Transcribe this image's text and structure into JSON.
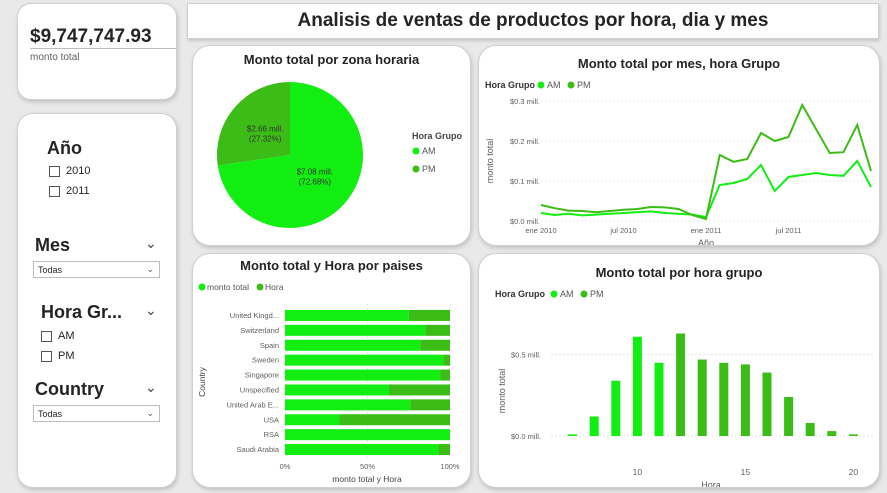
{
  "dashboard": {
    "title": "Analisis de ventas de productos por hora, dia y mes"
  },
  "kpi": {
    "value": "$9,747,747.93",
    "label": "monto total"
  },
  "slicers": {
    "year": {
      "title": "Año",
      "options": [
        "2010",
        "2011"
      ]
    },
    "month": {
      "title": "Mes",
      "selected": "Todas"
    },
    "hour_group": {
      "title": "Hora Gr...",
      "options": [
        "AM",
        "PM"
      ]
    },
    "country": {
      "title": "Country",
      "selected": "Todas"
    }
  },
  "colors": {
    "am": "#12ee12",
    "pm": "#3cbc16",
    "grid": "#e4e4e4",
    "axis_text": "#605e5c"
  },
  "chart_data": [
    {
      "id": "pie",
      "type": "pie",
      "title": "Monto total por zona horaria",
      "legend_title": "Hora Grupo",
      "legend_position": "right",
      "slices": [
        {
          "name": "AM",
          "value": 7.08,
          "label": "$7.08 mill.",
          "percent": "(72.68%)",
          "color": "#12ee12"
        },
        {
          "name": "PM",
          "value": 2.66,
          "label": "$2.66 mill.",
          "percent": "(27.32%)",
          "color": "#3cbc16"
        }
      ]
    },
    {
      "id": "line",
      "type": "line",
      "title": "Monto total por mes, hora Grupo",
      "legend_title": "Hora Grupo",
      "legend_position": "top-left",
      "xlabel": "Año",
      "ylabel": "monto total",
      "x_ticks": [
        {
          "label": "ene 2010",
          "index": 0
        },
        {
          "label": "jul 2010",
          "index": 6
        },
        {
          "label": "ene 2011",
          "index": 12
        },
        {
          "label": "jul 2011",
          "index": 18
        }
      ],
      "y_ticks": [
        {
          "label": "$0.0 mill.",
          "value": 0.0
        },
        {
          "label": "$0.1 mill.",
          "value": 0.1
        },
        {
          "label": "$0.2 mill.",
          "value": 0.2
        },
        {
          "label": "$0.3 mill.",
          "value": 0.3
        }
      ],
      "ylim": [
        0,
        0.3
      ],
      "x_count": 24,
      "series": [
        {
          "name": "AM",
          "color": "#12ee12",
          "values": [
            0.02,
            0.015,
            0.018,
            0.014,
            0.016,
            0.018,
            0.02,
            0.022,
            0.024,
            0.02,
            0.018,
            0.016,
            0.01,
            0.09,
            0.095,
            0.105,
            0.14,
            0.075,
            0.11,
            0.115,
            0.12,
            0.115,
            0.113,
            0.15,
            0.085
          ]
        },
        {
          "name": "PM",
          "color": "#3cbc16",
          "values": [
            0.04,
            0.032,
            0.026,
            0.025,
            0.022,
            0.025,
            0.028,
            0.03,
            0.035,
            0.034,
            0.03,
            0.015,
            0.005,
            0.165,
            0.148,
            0.155,
            0.22,
            0.2,
            0.21,
            0.29,
            0.23,
            0.17,
            0.172,
            0.24,
            0.125
          ]
        }
      ]
    },
    {
      "id": "hbar",
      "type": "bar",
      "orientation": "horizontal",
      "stacked_percent": true,
      "title": "Monto total y Hora por paises",
      "legend_position": "top-left",
      "legend": [
        "monto total",
        "Hora"
      ],
      "xlabel": "monto total y Hora",
      "ylabel": "Country",
      "x_ticks": [
        "0%",
        "50%",
        "100%"
      ],
      "categories": [
        "United Kingd...",
        "Switzerland",
        "Spain",
        "Sweden",
        "Singapore",
        "Unspecified",
        "United Arab E...",
        "USA",
        "RSA",
        "Saudi Arabia"
      ],
      "series": [
        {
          "name": "monto total",
          "color": "#12ee12",
          "values": [
            0.75,
            0.85,
            0.82,
            0.96,
            0.94,
            0.63,
            0.76,
            0.33,
            1.0,
            0.93
          ]
        },
        {
          "name": "Hora",
          "color": "#3cbc16",
          "values": [
            0.25,
            0.15,
            0.18,
            0.04,
            0.06,
            0.37,
            0.24,
            0.67,
            0.0,
            0.07
          ]
        }
      ]
    },
    {
      "id": "vbar",
      "type": "bar",
      "title": "Monto total por hora grupo",
      "legend_title": "Hora Grupo",
      "legend_position": "top-left",
      "xlabel": "Hora",
      "ylabel": "monto total",
      "x_ticks": [
        10,
        15,
        20
      ],
      "y_ticks": [
        {
          "label": "$0.0 mill.",
          "value": 0.0
        },
        {
          "label": "$0.5 mill.",
          "value": 0.5
        }
      ],
      "ylim": [
        0,
        0.75
      ],
      "xlim": [
        6,
        21
      ],
      "series": [
        {
          "name": "AM",
          "color": "#12ee12",
          "points": [
            [
              7,
              0.01
            ],
            [
              8,
              0.12
            ],
            [
              9,
              0.34
            ],
            [
              10,
              0.61
            ],
            [
              11,
              0.45
            ],
            [
              12,
              0.0
            ]
          ]
        },
        {
          "name": "PM",
          "color": "#3cbc16",
          "points": [
            [
              12,
              0.63
            ],
            [
              13,
              0.47
            ],
            [
              14,
              0.45
            ],
            [
              15,
              0.44
            ],
            [
              16,
              0.39
            ],
            [
              17,
              0.24
            ],
            [
              18,
              0.08
            ],
            [
              19,
              0.03
            ],
            [
              20,
              0.01
            ]
          ]
        }
      ]
    }
  ]
}
